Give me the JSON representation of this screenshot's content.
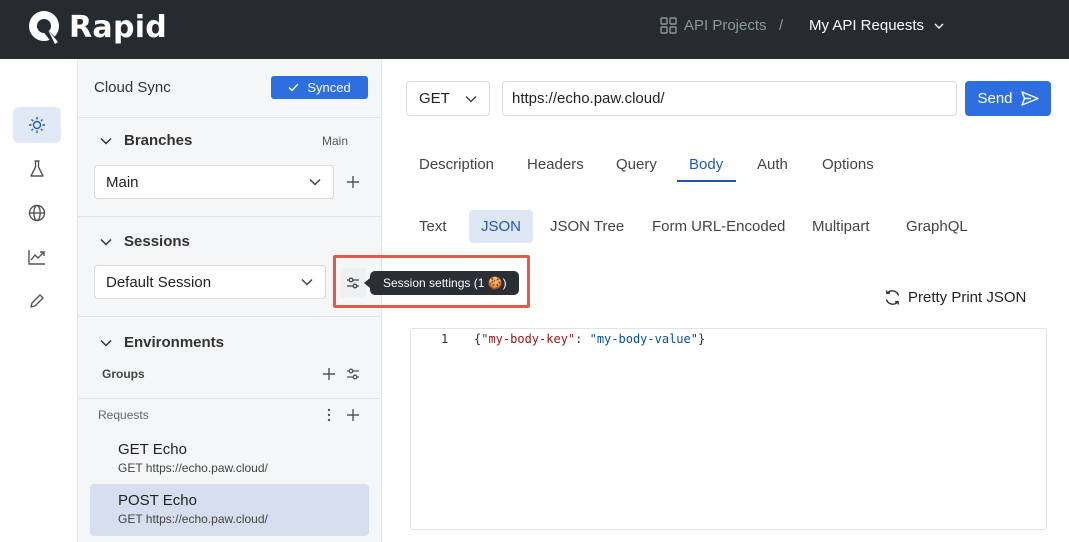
{
  "app": {
    "logo_text": "Rapid"
  },
  "breadcrumb": {
    "projects": "API Projects",
    "separator": "/",
    "current": "My API Requests"
  },
  "rail": {
    "icons": [
      "api-icon",
      "flask-icon",
      "globe-icon",
      "chart-icon",
      "pencil-icon"
    ]
  },
  "sidebar": {
    "title": "Cloud Sync",
    "synced_label": "Synced",
    "branches": {
      "title": "Branches",
      "meta": "Main",
      "selected": "Main"
    },
    "sessions": {
      "title": "Sessions",
      "selected": "Default Session"
    },
    "tooltip": "Session settings (1 🍪)",
    "environments": {
      "title": "Environments",
      "groups_label": "Groups"
    },
    "requests": {
      "label": "Requests",
      "items": [
        {
          "name": "GET Echo",
          "url": "GET https://echo.paw.cloud/"
        },
        {
          "name": "POST Echo",
          "url": "GET https://echo.paw.cloud/"
        }
      ]
    }
  },
  "request": {
    "method": "GET",
    "url": "https://echo.paw.cloud/",
    "send_label": "Send",
    "tabs": [
      "Description",
      "Headers",
      "Query",
      "Body",
      "Auth",
      "Options"
    ],
    "active_tab": "Body",
    "body_tabs": [
      "Text",
      "JSON",
      "JSON Tree",
      "Form URL-Encoded",
      "Multipart",
      "GraphQL"
    ],
    "active_body_tab": "JSON",
    "pretty_label": "Pretty Print JSON",
    "editor": {
      "line": "1",
      "open": "{",
      "key": "\"my-body-key\"",
      "colon": ": ",
      "value": "\"my-body-value\"",
      "close": "}"
    }
  },
  "colors": {
    "accent": "#2d6fe0",
    "topbar": "#262b30",
    "highlight": "#e35b4a"
  }
}
